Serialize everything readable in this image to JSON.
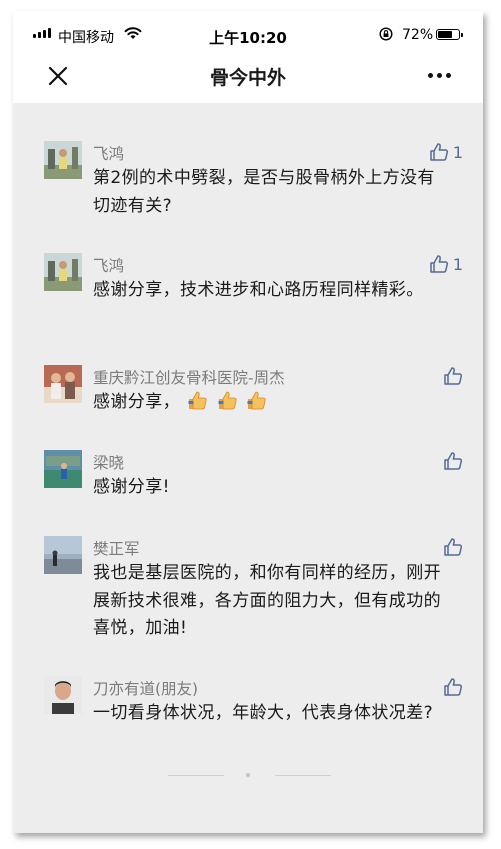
{
  "status_bar": {
    "carrier": "中国移动",
    "time": "上午10:20",
    "battery_percent": "72%",
    "battery_level": 0.72
  },
  "nav": {
    "title": "骨今中外",
    "close_icon": "close-icon",
    "more_icon": "more-icon"
  },
  "comments": [
    {
      "name": "飞鸿",
      "text": "第2例的术中劈裂，是否与股骨柄外上方没有切迹有关?",
      "likes": "1"
    },
    {
      "name": "飞鸿",
      "text": "感谢分享，技术进步和心路历程同样精彩。",
      "likes": "1"
    },
    {
      "name": "重庆黔江创友骨科医院-周杰",
      "text": "感谢分享，",
      "likes": "",
      "emoji": "thumbs-up-emoji x3"
    },
    {
      "name": "梁晓",
      "text": "感谢分享!",
      "likes": ""
    },
    {
      "name": "樊正军",
      "text": "我也是基层医院的，和你有同样的经历，刚开展新技术很难，各方面的阻力大，但有成功的喜悦，加油!",
      "likes": ""
    },
    {
      "name": "刀亦有道(朋友)",
      "text": "一切看身体状况，年龄大，代表身体状况差?",
      "likes": ""
    }
  ],
  "colors": {
    "link_blue": "#576b95",
    "background": "#ededed",
    "name_gray": "#7b7b7b"
  }
}
